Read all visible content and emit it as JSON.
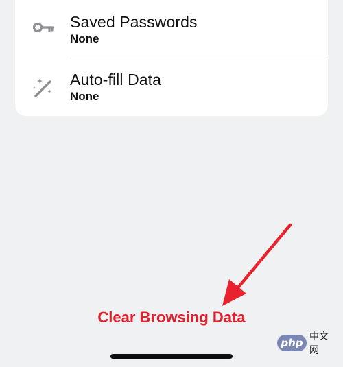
{
  "items": [
    {
      "label": "Saved Passwords",
      "value": "None",
      "icon": "key-icon"
    },
    {
      "label": "Auto-fill Data",
      "value": "None",
      "icon": "magic-wand-icon"
    }
  ],
  "clear_button": {
    "label": "Clear Browsing Data"
  },
  "watermark": {
    "logo": "php",
    "text": "中文网"
  },
  "colors": {
    "background": "#eff1f2",
    "card": "#ffffff",
    "destructive": "#e0202c",
    "icon": "#8e8e93",
    "annotation_arrow": "#e8232f"
  }
}
